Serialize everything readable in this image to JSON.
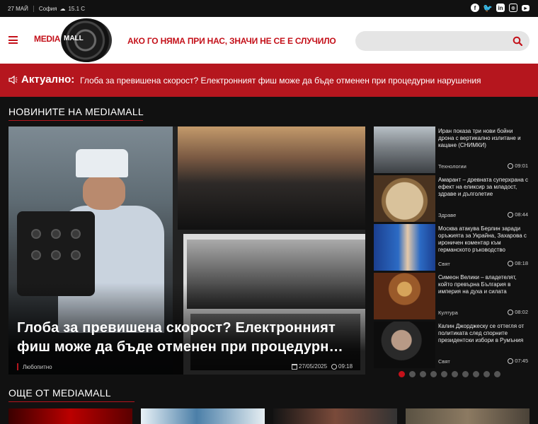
{
  "topbar": {
    "date": "27 МАЙ",
    "city": "София",
    "temperature": "15.1 С"
  },
  "social": [
    "facebook-icon",
    "twitter-icon",
    "linkedin-icon",
    "instagram-icon",
    "youtube-icon"
  ],
  "header": {
    "logo_media": "MEDIA",
    "logo_mall": "MALL",
    "slogan": "АКО ГО НЯМА ПРИ НАС, ЗНАЧИ НЕ СЕ Е СЛУЧИЛО",
    "search_placeholder": ""
  },
  "breaking": {
    "label": "Актуално:",
    "text": "Глоба за превишена скорост? Електронният фиш може да бъде отменен при процедурни нарушения"
  },
  "news_section": {
    "title": "НОВИНИТЕ НА MEDIAMALL"
  },
  "hero": {
    "title": "Глоба за превишена скорост? Електронният фиш може да бъде отменен при процедурн…",
    "category": "Любопитно",
    "date": "27/05/2025",
    "time": "09:18"
  },
  "side_items": [
    {
      "title": "Иран показа три нови бойни дрона с вертикално излитане и кацане (СНИМКИ)",
      "category": "Технологии",
      "time": "09:01"
    },
    {
      "title": "Амарант – древната суперхрана с ефект на еликсир за младост, здраве и дълголетие",
      "category": "Здраве",
      "time": "08:44"
    },
    {
      "title": "Москва атакува Берлин заради оръжията за Украйна, Захарова с ироничен коментар към германското ръководство",
      "category": "Свят",
      "time": "08:18"
    },
    {
      "title": "Симеон Велики – владетелят, който превърна България в империя на духа и силата",
      "category": "Култура",
      "time": "08:02"
    },
    {
      "title": "Калин Джорджеску се оттегля от политиката след спорните президентски избори в Румъния",
      "category": "Свят",
      "time": "07:45"
    }
  ],
  "slider": {
    "total": 10,
    "active": 1
  },
  "more_section": {
    "title": "ОЩЕ ОТ MEDIAMALL"
  },
  "colors": {
    "accent": "#c4111a",
    "breaking_bg": "#b5161e",
    "page_bg": "#111111"
  }
}
